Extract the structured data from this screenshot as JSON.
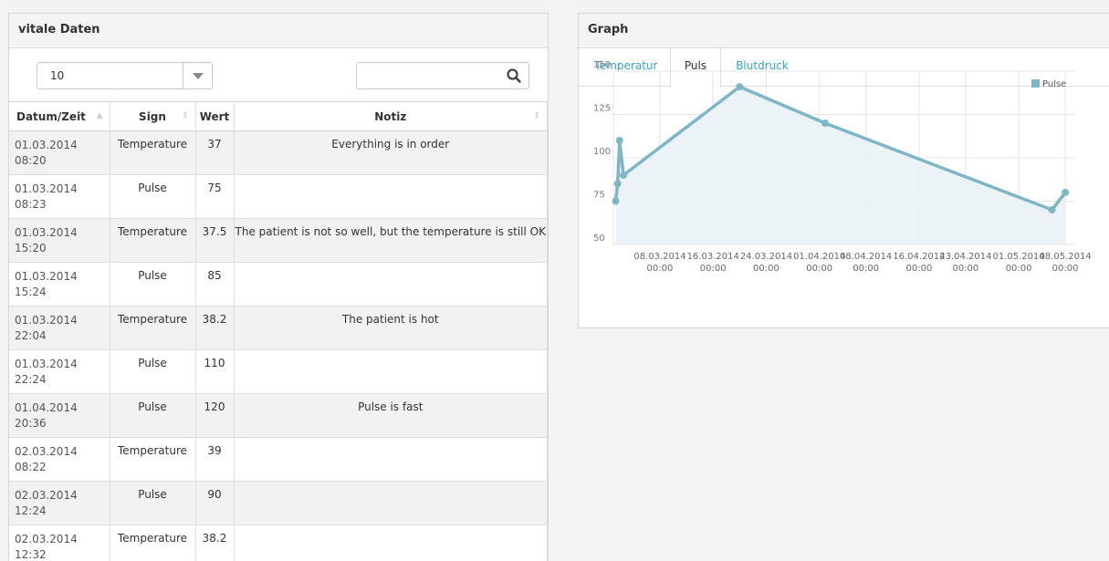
{
  "vitals": {
    "title": "vitale Daten",
    "page_size": "10",
    "search": {
      "value": "",
      "placeholder": ""
    },
    "columns": [
      "Datum/Zeit",
      "Sign",
      "Wert",
      "Notiz"
    ],
    "rows": [
      {
        "date": "01.03.2014",
        "time": "08:20",
        "sign": "Temperature",
        "value": "37",
        "note": "Everything is in order"
      },
      {
        "date": "01.03.2014",
        "time": "08:23",
        "sign": "Pulse",
        "value": "75",
        "note": ""
      },
      {
        "date": "01.03.2014",
        "time": "15:20",
        "sign": "Temperature",
        "value": "37.5",
        "note": "The patient is not so well, but the temperature is still OK"
      },
      {
        "date": "01.03.2014",
        "time": "15:24",
        "sign": "Pulse",
        "value": "85",
        "note": ""
      },
      {
        "date": "01.03.2014",
        "time": "22:04",
        "sign": "Temperature",
        "value": "38.2",
        "note": "The patient is hot"
      },
      {
        "date": "01.03.2014",
        "time": "22:24",
        "sign": "Pulse",
        "value": "110",
        "note": ""
      },
      {
        "date": "01.04.2014",
        "time": "20:36",
        "sign": "Pulse",
        "value": "120",
        "note": "Pulse is fast"
      },
      {
        "date": "02.03.2014",
        "time": "08:22",
        "sign": "Temperature",
        "value": "39",
        "note": ""
      },
      {
        "date": "02.03.2014",
        "time": "12:24",
        "sign": "Pulse",
        "value": "90",
        "note": ""
      },
      {
        "date": "02.03.2014",
        "time": "12:32",
        "sign": "Temperature",
        "value": "38.2",
        "note": ""
      }
    ]
  },
  "graph": {
    "title": "Graph",
    "tabs": [
      "Temperatur",
      "Puls",
      "Blutdruck"
    ],
    "active_tab": "Puls"
  },
  "colors": {
    "line": "#7fb6c6",
    "area": "#e9f2f6",
    "link": "#3a9fc2"
  },
  "chart_data": {
    "type": "line",
    "ylim": [
      50,
      150
    ],
    "yticks": [
      50,
      75,
      100,
      125,
      150
    ],
    "xticks": [
      {
        "date": "08.03.2014",
        "time": "00:00"
      },
      {
        "date": "16.03.2014",
        "time": "00:00"
      },
      {
        "date": "24.03.2014",
        "time": "00:00"
      },
      {
        "date": "01.04.2014",
        "time": "00:00"
      },
      {
        "date": "08.04.2014",
        "time": "00:00"
      },
      {
        "date": "16.04.2014",
        "time": "00:00"
      },
      {
        "date": "23.04.2014",
        "time": "00:00"
      },
      {
        "date": "01.05.2014",
        "time": "00:00"
      },
      {
        "date": "08.05.2014",
        "time": "00:00"
      }
    ],
    "series": [
      {
        "name": "Pulse",
        "points": [
          {
            "x": "01.03.2014 08:23",
            "y": 75
          },
          {
            "x": "01.03.2014 15:24",
            "y": 85
          },
          {
            "x": "01.03.2014 22:24",
            "y": 110
          },
          {
            "x": "02.03.2014 12:24",
            "y": 90
          },
          {
            "x": "20.03.2014 00:00",
            "y": 141
          },
          {
            "x": "01.04.2014 20:36",
            "y": 120
          },
          {
            "x": "06.05.2014 00:00",
            "y": 70
          },
          {
            "x": "08.05.2014 00:00",
            "y": 80
          }
        ]
      }
    ],
    "legend": "top-right",
    "grid": true
  }
}
